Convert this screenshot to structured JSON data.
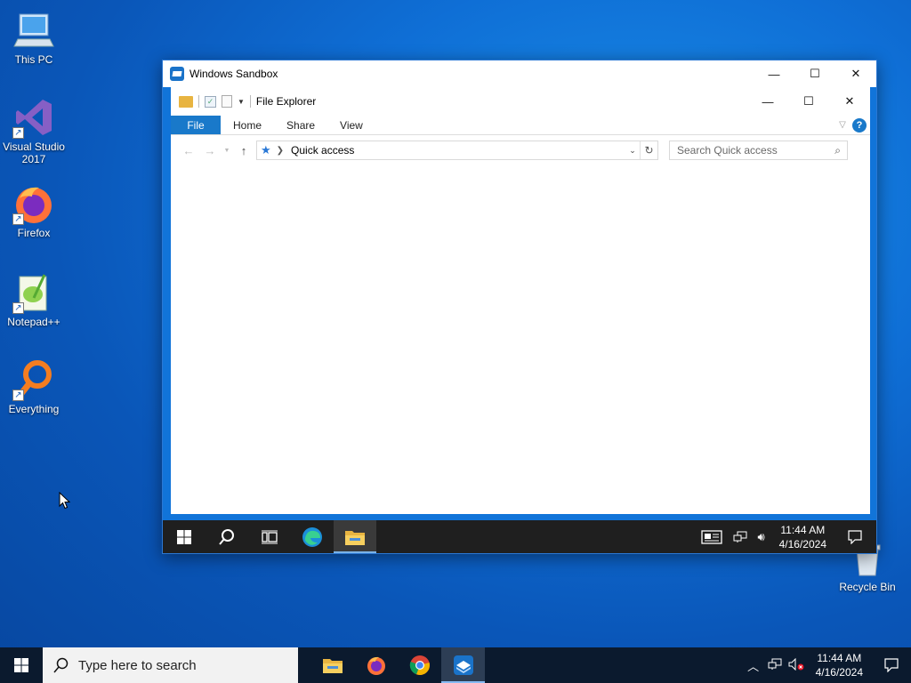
{
  "desktop": {
    "icons": [
      {
        "label": "This PC",
        "icon": "computer-icon"
      },
      {
        "label": "Visual Studio 2017",
        "icon": "visual-studio-icon"
      },
      {
        "label": "Firefox",
        "icon": "firefox-icon"
      },
      {
        "label": "Notepad++",
        "icon": "notepad-plus-plus-icon"
      },
      {
        "label": "Everything",
        "icon": "everything-search-icon"
      },
      {
        "label": "Recycle Bin",
        "icon": "recycle-bin-icon"
      }
    ]
  },
  "sandbox": {
    "title": "Windows Sandbox",
    "minimize": "—",
    "maximize": "☐",
    "close": "✕"
  },
  "explorer": {
    "title": "File Explorer",
    "tabs": [
      "File",
      "Home",
      "Share",
      "View"
    ],
    "address": "Quick access",
    "search_placeholder": "Search Quick access",
    "help": "?"
  },
  "guest_taskbar": {
    "time": "11:44 AM",
    "date": "4/16/2024"
  },
  "taskbar": {
    "search_placeholder": "Type here to search",
    "time": "11:44 AM",
    "date": "4/16/2024"
  },
  "colors": {
    "accent": "#1979ca",
    "taskbar": "#0b1a2e",
    "guest_taskbar": "#1f1f1f"
  }
}
